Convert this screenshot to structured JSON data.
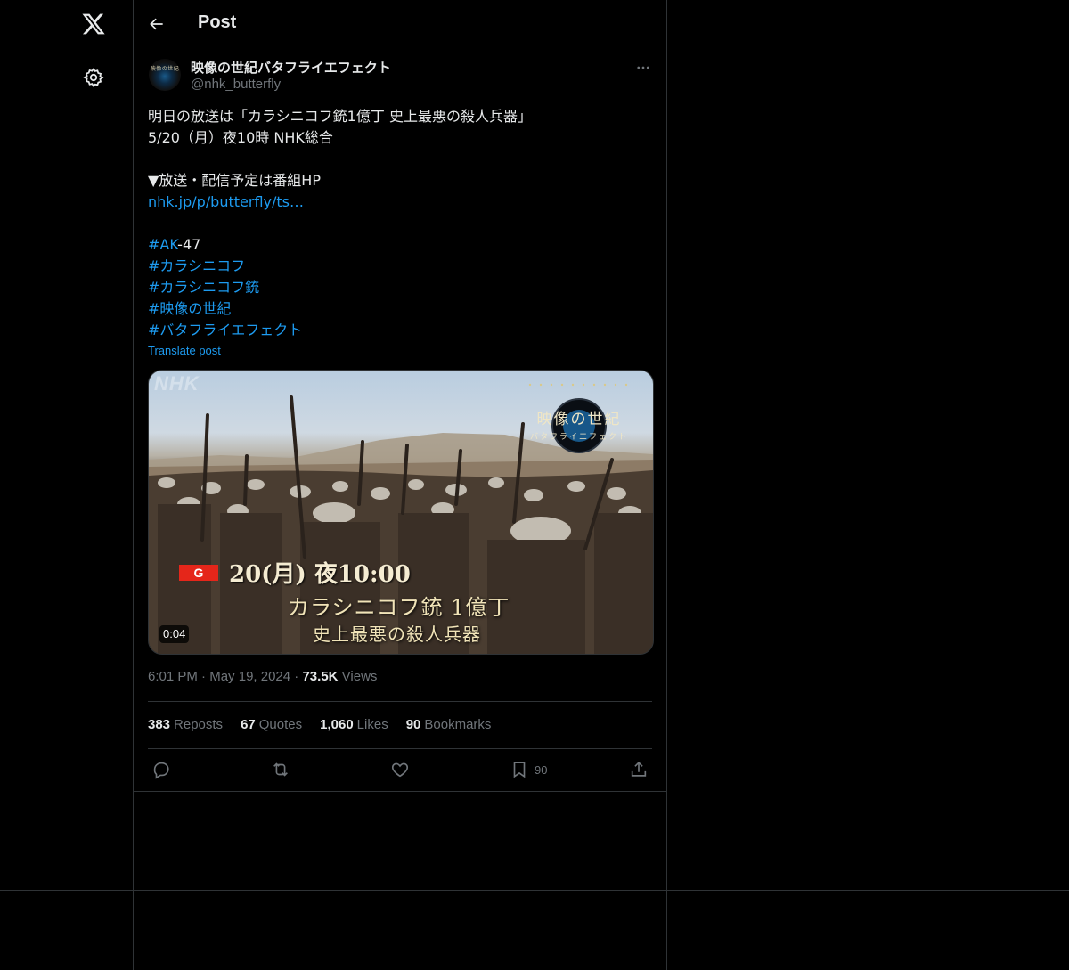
{
  "nav": {
    "logo_icon": "x-logo-icon",
    "settings_icon": "gear-icon"
  },
  "header": {
    "title": "Post",
    "back_icon": "arrow-left-icon"
  },
  "author": {
    "display_name": "映像の世紀バタフライエフェクト",
    "handle": "@nhk_butterfly",
    "avatar_text": "映像の世紀"
  },
  "post": {
    "line1": "明日の放送は「カラシニコフ銃1億丁 史上最悪の殺人兵器」",
    "line2": "5/20（月）夜10時 NHK総合",
    "line3": "▼放送・配信予定は番組HP",
    "link": "nhk.jp/p/butterfly/ts…",
    "hashtag1_tag": "#AK",
    "hashtag1_rest": "-47",
    "hashtag2": "#カラシニコフ",
    "hashtag3": "#カラシニコフ銃",
    "hashtag4": "#映像の世紀",
    "hashtag5": "#バタフライエフェクト",
    "translate": "Translate post"
  },
  "media": {
    "watermark": "NHK",
    "series_title": "映像の世紀",
    "series_sub": "バタフライエフェクト",
    "channel": "G",
    "air_time": "20(月) 夜10:00",
    "title": "カラシニコフ銃 1億丁",
    "subtitle": "史上最悪の殺人兵器",
    "duration": "0:04"
  },
  "meta": {
    "time": "6:01 PM",
    "date": "May 19, 2024",
    "views_count": "73.5K",
    "views_label": "Views",
    "separator": "·"
  },
  "stats": {
    "reposts_count": "383",
    "reposts_label": "Reposts",
    "quotes_count": "67",
    "quotes_label": "Quotes",
    "likes_count": "1,060",
    "likes_label": "Likes",
    "bookmarks_count": "90",
    "bookmarks_label": "Bookmarks"
  },
  "actions": {
    "reply_icon": "reply-icon",
    "repost_icon": "repost-icon",
    "like_icon": "heart-icon",
    "bookmark_icon": "bookmark-icon",
    "bookmark_count": "90",
    "share_icon": "share-icon"
  },
  "colors": {
    "background": "#000000",
    "text": "#e7e9ea",
    "muted": "#71767b",
    "link": "#1d9bf0",
    "border": "#2f3336",
    "channel_badge": "#e5261a"
  }
}
